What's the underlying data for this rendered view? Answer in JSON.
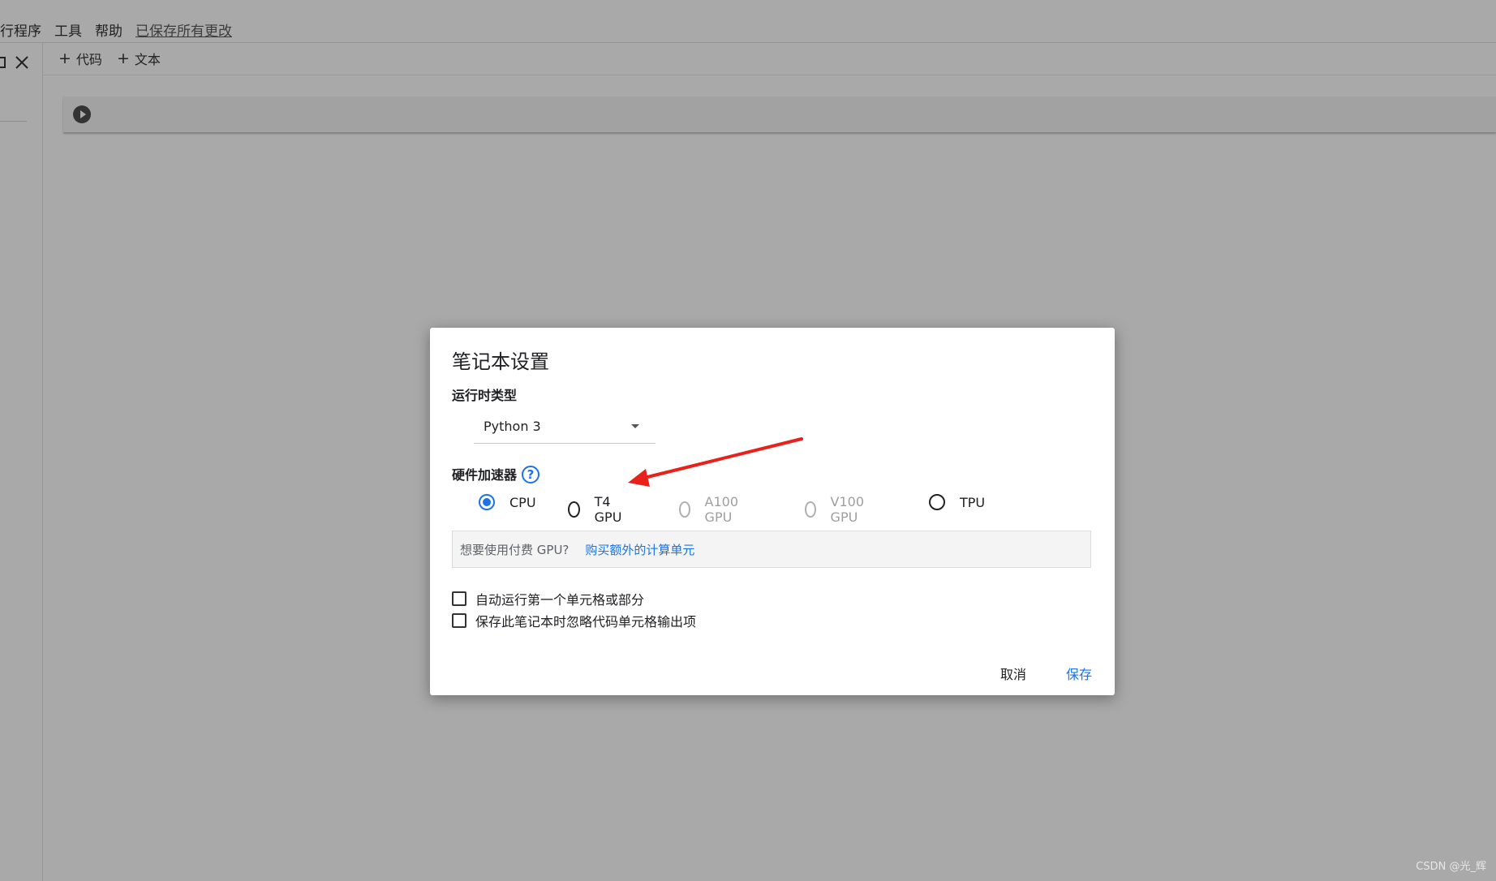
{
  "menubar": {
    "items": [
      "行程序",
      "工具",
      "帮助"
    ],
    "saved_status": "已保存所有更改"
  },
  "toolbar": {
    "add_code_label": "代码",
    "add_text_label": "文本"
  },
  "dialog": {
    "title": "笔记本设置",
    "runtime_type_label": "运行时类型",
    "runtime_type_value": "Python 3",
    "hardware_accelerator_label": "硬件加速器",
    "help_glyph": "?",
    "accelerators": [
      {
        "label": "CPU",
        "state": "checked"
      },
      {
        "label": "T4 GPU",
        "state": "enabled"
      },
      {
        "label": "A100 GPU",
        "state": "disabled"
      },
      {
        "label": "V100 GPU",
        "state": "disabled"
      },
      {
        "label": "TPU",
        "state": "enabled"
      }
    ],
    "paid_gpu_question": "想要使用付费 GPU?",
    "buy_compute_link": "购买额外的计算单元",
    "options": [
      {
        "label": "自动运行第一个单元格或部分",
        "checked": false
      },
      {
        "label": "保存此笔记本时忽略代码单元格输出项",
        "checked": false
      }
    ],
    "cancel_label": "取消",
    "save_label": "保存"
  },
  "annotation": {
    "arrow_color": "#e8211b"
  },
  "watermark": "CSDN @光_辉",
  "colors": {
    "accent": "#1a73e8",
    "overlay": "#a9a9a9"
  }
}
